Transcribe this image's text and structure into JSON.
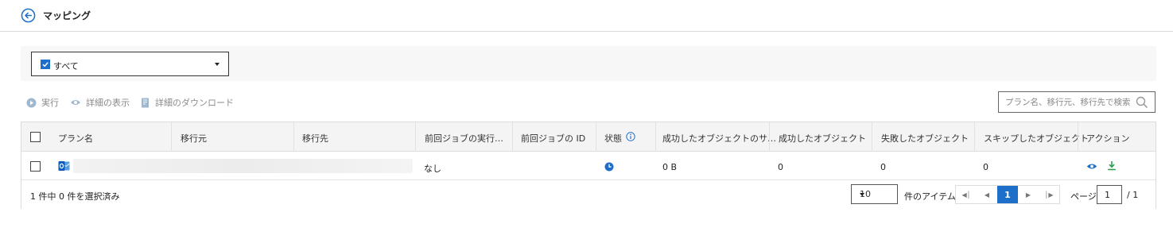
{
  "header": {
    "title": "マッピング"
  },
  "filter": {
    "value": "すべて"
  },
  "toolbar": {
    "run": "実行",
    "view_details": "詳細の表示",
    "download_details": "詳細のダウンロード"
  },
  "search": {
    "placeholder": "プラン名、移行元、移行先で検索"
  },
  "table": {
    "columns": {
      "plan_name": "プラン名",
      "source": "移行元",
      "destination": "移行先",
      "last_job_run": "前回ジョブの実行…",
      "last_job_id": "前回ジョブの ID",
      "status": "状態",
      "succeeded_size": "成功したオブジェクトのサ…",
      "succeeded_objects": "成功したオブジェクト",
      "failed_objects": "失敗したオブジェクト",
      "skipped_objects": "スキップしたオブジェクト",
      "actions": "アクション"
    },
    "rows": [
      {
        "last_job_run": "なし",
        "succeeded_size": "0 B",
        "succeeded_objects": "0",
        "failed_objects": "0",
        "skipped_objects": "0"
      }
    ]
  },
  "footer": {
    "selection": "1 件中 0 件を選択済み",
    "page_size": "10",
    "items_label": "件のアイテム",
    "current_page": "1",
    "page_label": "ページ",
    "page_input": "1",
    "page_total": "/ 1"
  },
  "colors": {
    "accent": "#1e6fc9",
    "download": "#2e9e4f",
    "toolbar_disabled": "#8a8a8a"
  },
  "icons": {
    "back": "arrow-left-circle-icon",
    "filter": "checkbox-icon",
    "run": "play-icon",
    "view": "eye-icon",
    "download": "document-download-icon",
    "search": "search-icon",
    "status_info": "info-icon",
    "row_app": "outlook-icon",
    "row_status": "clock-icon",
    "row_view": "eye-icon",
    "row_download": "download-icon"
  }
}
